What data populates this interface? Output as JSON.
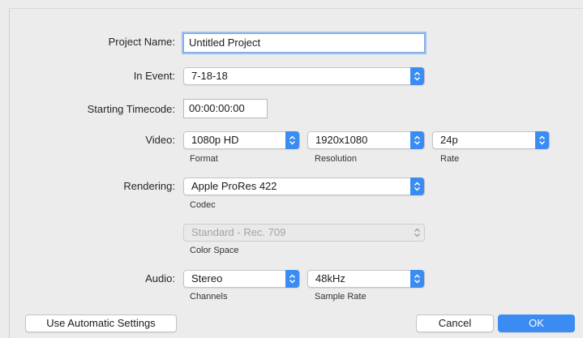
{
  "project_name": {
    "label": "Project Name:",
    "value": "Untitled Project"
  },
  "in_event": {
    "label": "In Event:",
    "value": "7-18-18"
  },
  "starting_timecode": {
    "label": "Starting Timecode:",
    "value": "00:00:00:00"
  },
  "video": {
    "label": "Video:",
    "format": {
      "value": "1080p HD",
      "caption": "Format"
    },
    "resolution": {
      "value": "1920x1080",
      "caption": "Resolution"
    },
    "rate": {
      "value": "24p",
      "caption": "Rate"
    }
  },
  "rendering": {
    "label": "Rendering:",
    "codec": {
      "value": "Apple ProRes 422",
      "caption": "Codec"
    },
    "color_space": {
      "value": "Standard - Rec. 709",
      "caption": "Color Space",
      "enabled": false
    }
  },
  "audio": {
    "label": "Audio:",
    "channels": {
      "value": "Stereo",
      "caption": "Channels"
    },
    "sample_rate": {
      "value": "48kHz",
      "caption": "Sample Rate"
    }
  },
  "buttons": {
    "automatic": "Use Automatic Settings",
    "cancel": "Cancel",
    "ok": "OK"
  },
  "icons": {
    "popup_arrow": "up-down-chevron-icon"
  },
  "colors": {
    "accent": "#3b8cf2",
    "background": "#ececec"
  }
}
